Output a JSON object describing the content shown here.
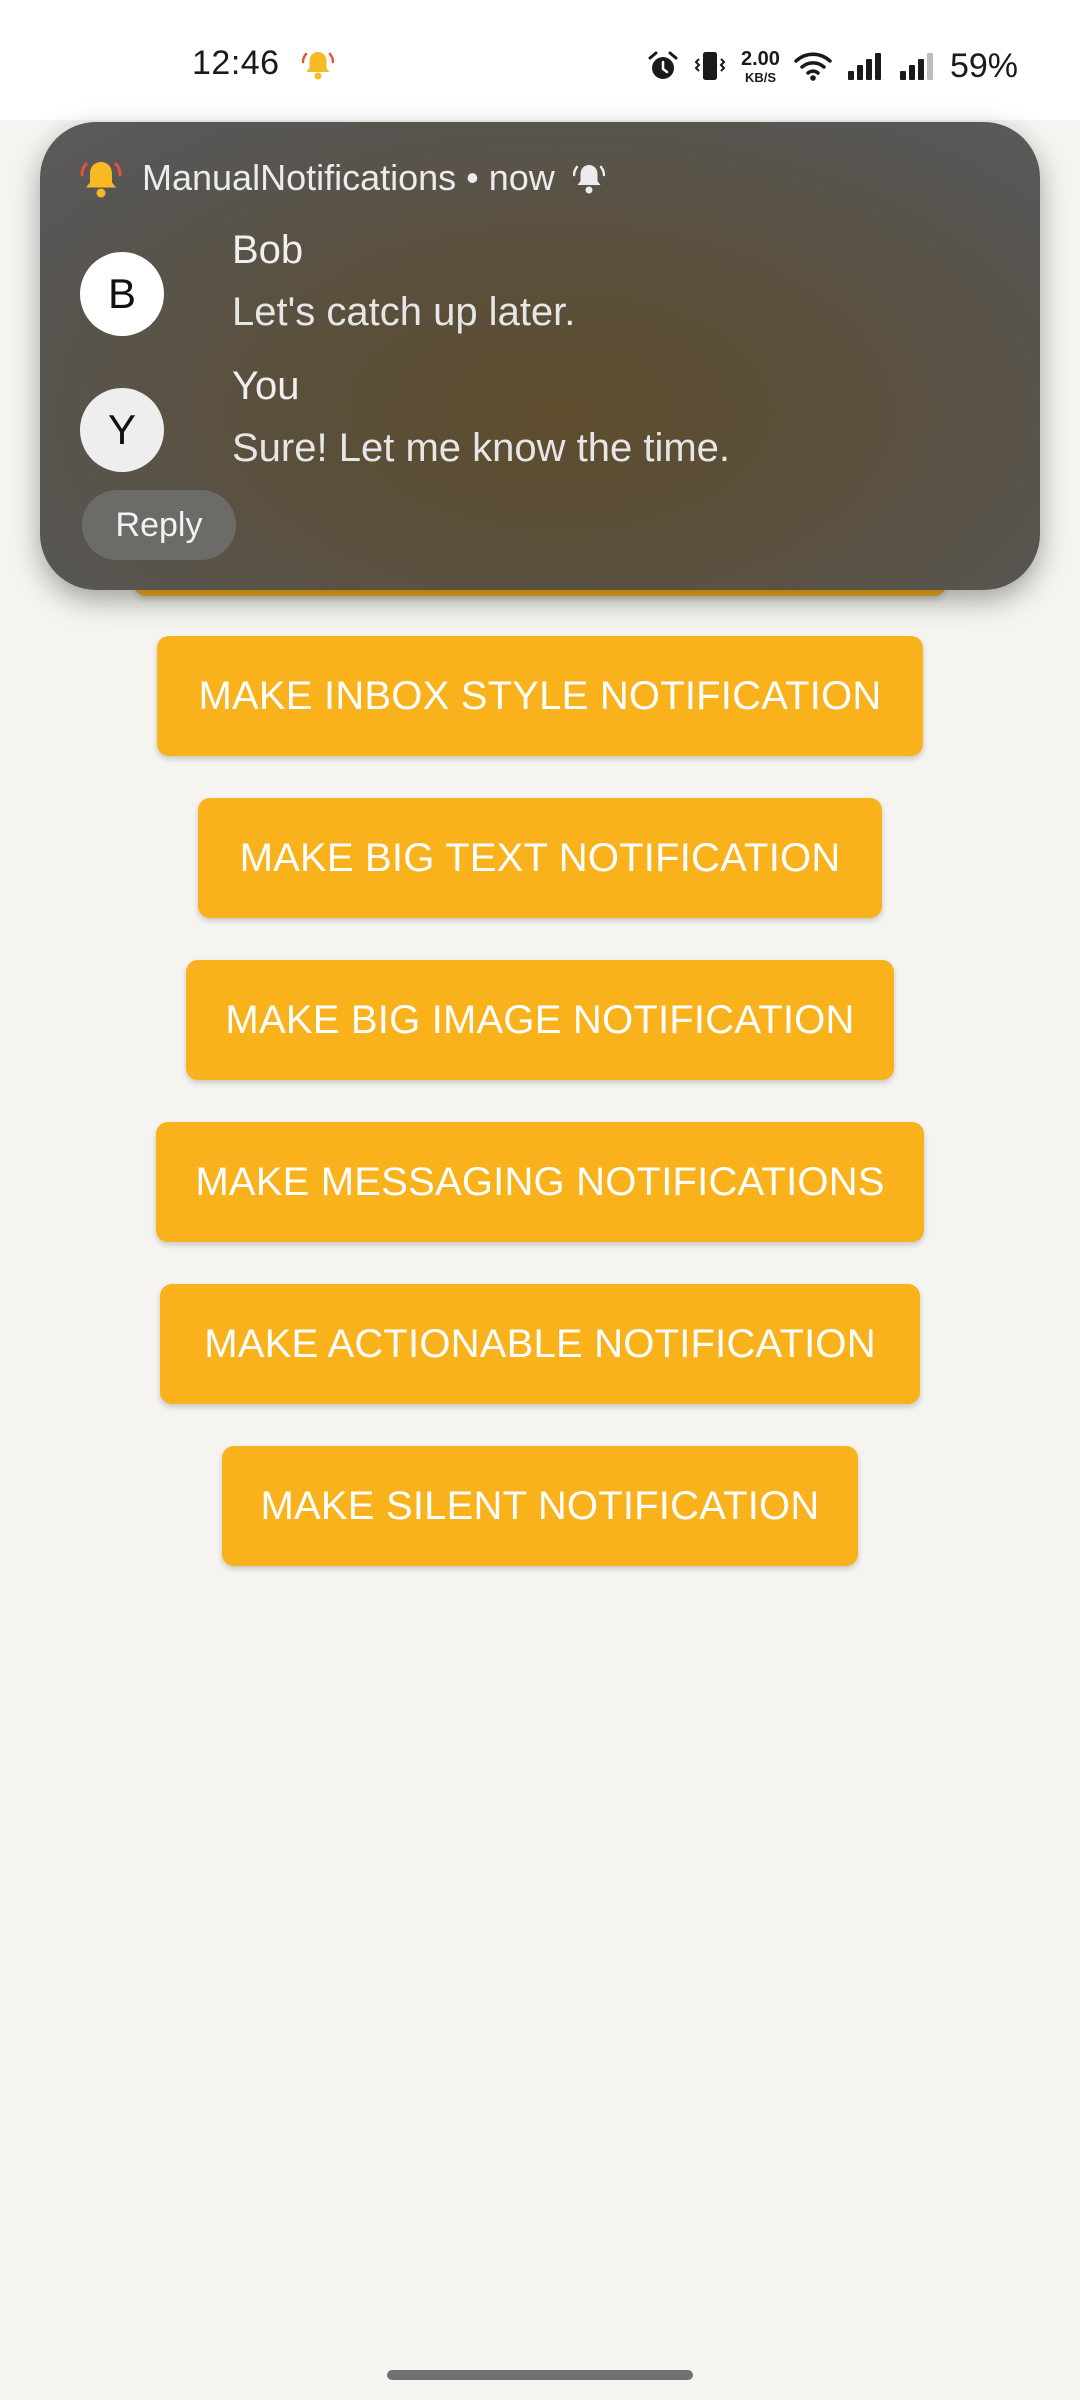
{
  "status_bar": {
    "time": "12:46",
    "net_speed_value": "2.00",
    "net_speed_unit": "KB/S",
    "battery": "59%",
    "icons": [
      "bell-ringing-icon",
      "alarm-icon",
      "vibrate-icon",
      "wifi-icon",
      "signal-icon",
      "signal-icon"
    ]
  },
  "notification": {
    "app_name": "ManualNotifications",
    "separator": "•",
    "time": "now",
    "messages": [
      {
        "avatar_letter": "B",
        "sender": "Bob",
        "text": "Let's catch up later."
      },
      {
        "avatar_letter": "Y",
        "sender": "You",
        "text": "Sure! Let me know the time."
      }
    ],
    "reply_label": "Reply"
  },
  "buttons": [
    {
      "label": "MAKE INBOX STYLE NOTIFICATION"
    },
    {
      "label": "MAKE BIG TEXT NOTIFICATION"
    },
    {
      "label": "MAKE BIG IMAGE NOTIFICATION"
    },
    {
      "label": "MAKE MESSAGING NOTIFICATIONS"
    },
    {
      "label": "MAKE ACTIONABLE NOTIFICATION"
    },
    {
      "label": "MAKE SILENT NOTIFICATION"
    }
  ],
  "colors": {
    "button_bg": "#f9b21c",
    "background": "#f5f4f0",
    "notification_bg": "#5a5751"
  }
}
